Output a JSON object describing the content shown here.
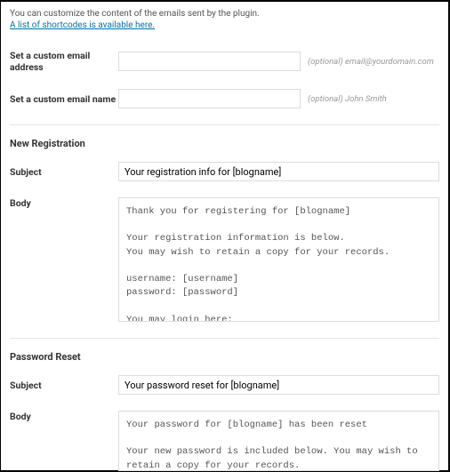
{
  "intro": {
    "text": "You can customize the content of the emails sent by the plugin.",
    "link_text": "A list of shortcodes is available here."
  },
  "email_address": {
    "label": "Set a custom email address",
    "value": "",
    "hint": "(optional) email@yourdomain.com"
  },
  "email_name": {
    "label": "Set a custom email name",
    "value": "",
    "hint": "(optional) John Smith"
  },
  "new_registration": {
    "heading": "New Registration",
    "subject_label": "Subject",
    "subject_value": "Your registration info for [blogname]",
    "body_label": "Body",
    "body_value": "Thank you for registering for [blogname]\n\nYour registration information is below.\nYou may wish to retain a copy for your records.\n\nusername: [username]\npassword: [password]\n\nYou may login here:\n[reglink]\n\nYou may change your password here:\n[members-area]"
  },
  "password_reset": {
    "heading": "Password Reset",
    "subject_label": "Subject",
    "subject_value": "Your password reset for [blogname]",
    "body_label": "Body",
    "body_value": "Your password for [blogname] has been reset\n\nYour new password is included below. You may wish to retain a copy for your records.\n\npassword: [password]"
  }
}
